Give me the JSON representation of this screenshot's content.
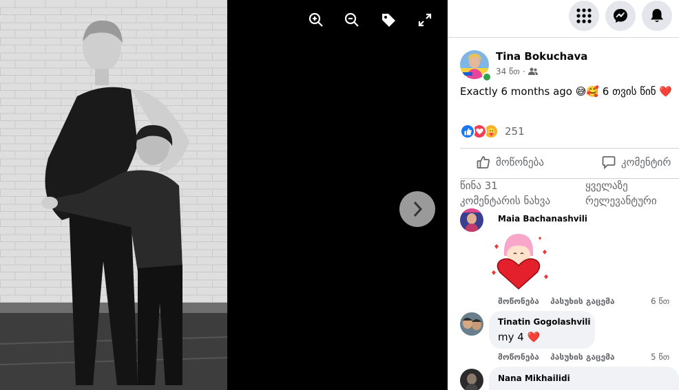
{
  "viewer": {
    "tools": [
      {
        "icon": "zoom-in-icon"
      },
      {
        "icon": "zoom-out-icon"
      },
      {
        "icon": "tag-icon"
      },
      {
        "icon": "fullscreen-icon"
      }
    ],
    "next_icon": "chevron-right-icon"
  },
  "topbar": {
    "icons": [
      "menu-grid-icon",
      "messenger-icon",
      "notifications-bell-icon"
    ]
  },
  "post": {
    "author": "Tina Bokuchava",
    "time": "34 წთ",
    "audience_icon": "friends-icon",
    "text": "Exactly 6 months ago 😅🥰 6 თვის წინ ❤️",
    "reaction_count": "251",
    "reaction_icons": [
      "like-icon",
      "love-icon",
      "care-icon"
    ]
  },
  "actions": {
    "like": "მოწონება",
    "comment": "კომენტირ"
  },
  "comment_controls": {
    "view_previous_line1": "წინა 31",
    "view_previous_line2": "კომენტარის ნახვა",
    "sort_line1": "ყველაზე",
    "sort_line2": "რელევანტური"
  },
  "comments": [
    {
      "author": "Maia Bachanashvili",
      "text": "",
      "has_sticker": true,
      "like": "მოწონება",
      "reply": "პასუხის გაცემა",
      "time": "6 წთ"
    },
    {
      "author": "Tinatin Gogolashvili",
      "text": "my 4 ❤️",
      "like": "მოწონება",
      "reply": "პასუხის გაცემა",
      "time": "5 წთ"
    },
    {
      "author": "Nana Mikhailidi",
      "text": ""
    }
  ],
  "colors": {
    "accent": "#1877f2",
    "reaction_love": "#f33e58",
    "reaction_care": "#f7b125"
  }
}
